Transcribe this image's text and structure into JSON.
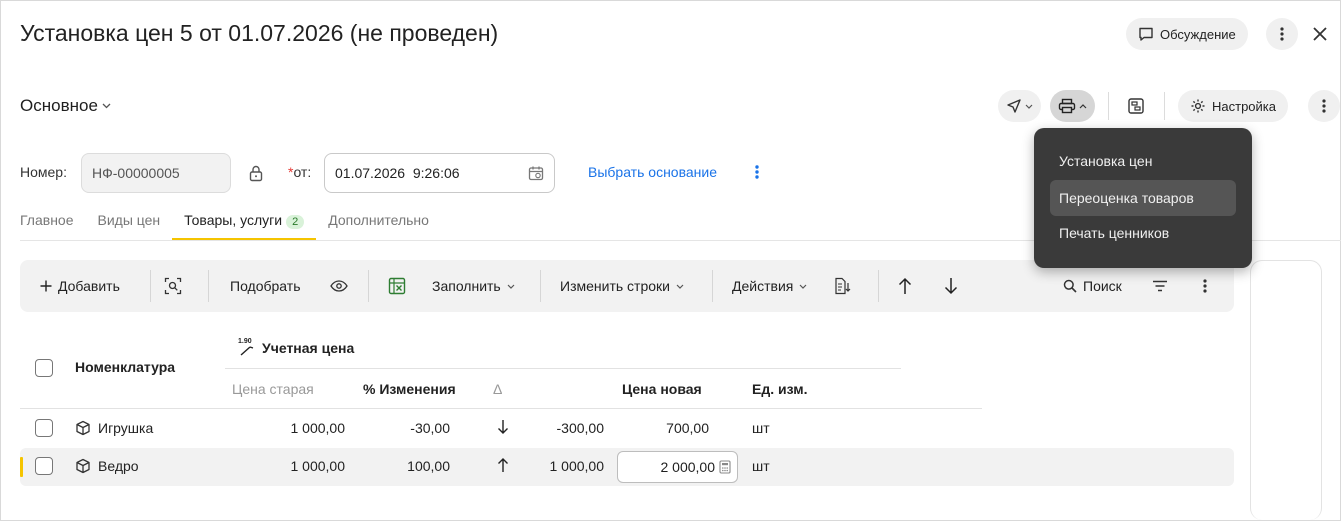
{
  "header": {
    "title": "Установка цен 5 от 01.07.2026 (не проведен)",
    "discussion_label": "Обсуждение"
  },
  "section": {
    "title": "Основное",
    "settings_label": "Настройка"
  },
  "form": {
    "number_label": "Номер:",
    "number_value": "НФ-00000005",
    "date_label": "*от:",
    "date_value": "01.07.2026  9:26:06",
    "basis_link": "Выбрать основание"
  },
  "tabs": [
    {
      "label": "Главное"
    },
    {
      "label": "Виды цен"
    },
    {
      "label": "Товары, услуги",
      "badge": "2"
    },
    {
      "label": "Дополнительно"
    }
  ],
  "toolbar": {
    "add_label": "Добавить",
    "pick_label": "Подобрать",
    "fill_label": "Заполнить",
    "change_rows_label": "Изменить строки",
    "actions_label": "Действия",
    "search_label": "Поиск"
  },
  "table": {
    "col_item": "Номенклатура",
    "group_title": "Учетная цена",
    "group_icon_text": "1.90",
    "col_old_price": "Цена старая",
    "col_change_pct": "% Изменения",
    "col_delta": "Δ",
    "col_new_price": "Цена новая",
    "col_unit": "Ед. изм.",
    "rows": [
      {
        "item": "Игрушка",
        "old_price": "1 000,00",
        "change_pct": "-30,00",
        "direction": "down",
        "delta": "-300,00",
        "new_price": "700,00",
        "unit": "шт"
      },
      {
        "item": "Ведро",
        "old_price": "1 000,00",
        "change_pct": "100,00",
        "direction": "up",
        "delta": "1 000,00",
        "new_price": "2 000,00",
        "unit": "шт"
      }
    ]
  },
  "print_menu": {
    "items": [
      {
        "label": "Установка цен"
      },
      {
        "label": "Переоценка товаров"
      },
      {
        "label": "Печать ценников"
      }
    ]
  },
  "colors": {
    "accent": "#f5c400",
    "link": "#1a73e8",
    "menu_bg": "#3a3a3a"
  }
}
